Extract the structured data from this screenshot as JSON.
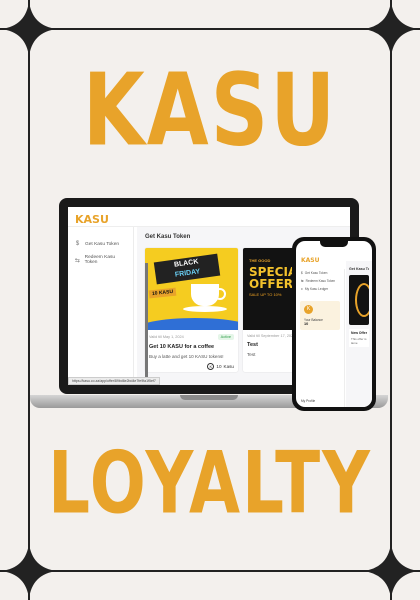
{
  "headline_top": "KASU",
  "headline_bottom": "LOYALTY",
  "colors": {
    "accent": "#e8a32a",
    "background": "#f3f0ed",
    "status_active": "#2c9b45"
  },
  "laptop": {
    "logo": "KASU",
    "sidebar": [
      {
        "icon": "dollar-icon",
        "glyph": "$",
        "label": "Get Kasu Token"
      },
      {
        "icon": "redeem-icon",
        "glyph": "⇆",
        "label": "Redeem Kasu Token"
      }
    ],
    "page_title": "Get Kasu Token",
    "cards": [
      {
        "date": "Valid till May 1, 2024",
        "status": "Active",
        "title": "Get 10 KASU for a coffee",
        "description": "Buy a latte and get 10 KASU tokens!",
        "reward": "10",
        "reward_unit": "Kasu",
        "art": {
          "line1": "BLACK",
          "line2": "FRIDAY",
          "banner": "10 KASU"
        }
      },
      {
        "date": "Valid till September 17, 2024",
        "status": "",
        "title": "Test",
        "description": "Test",
        "reward": "",
        "reward_unit": "",
        "art": {
          "small": "THE GOOD",
          "big1": "SPECIAL",
          "big2": "OFFER!",
          "sub": "SALE UP TO 10%"
        }
      }
    ],
    "status_url": "https://kasu.co.za/app/offer/89bd6e2bd4e7fe9fa1f5ef7"
  },
  "phone": {
    "logo": "KASU",
    "sidebar": [
      "Get Kasu Token",
      "Redeem Kasu Token",
      "My Kasu Ledger"
    ],
    "balance_label": "Your Balance",
    "balance_value": "10",
    "profile": "My Profile",
    "page_title": "Get Kasu Token",
    "card_title": "New Offer",
    "card_desc": "This offer is lame"
  }
}
